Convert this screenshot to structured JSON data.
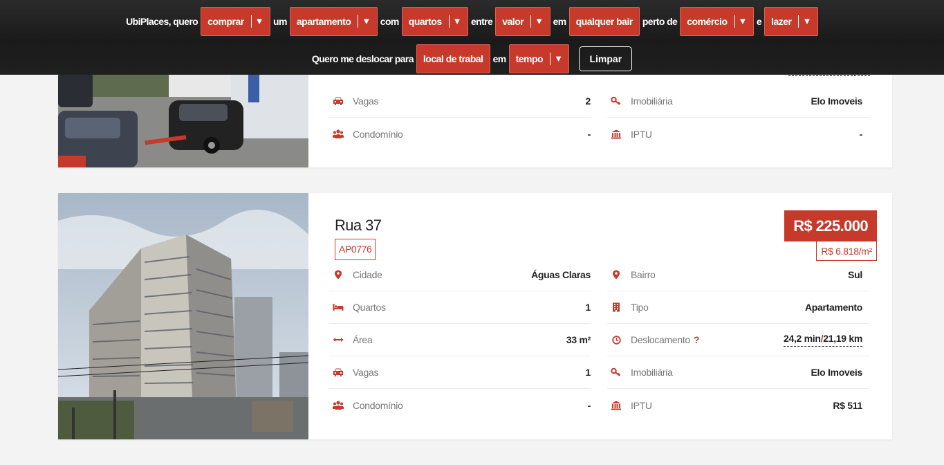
{
  "search_bar": {
    "row1": {
      "intro": "UbiPlaces, quero",
      "action": "comprar",
      "word_um": "um",
      "type": "apartamento",
      "word_com": "com",
      "rooms": "quartos",
      "word_entre": "entre",
      "price": "valor",
      "word_em": "em",
      "neighborhood": "qualquer bair",
      "word_perto": "perto de",
      "near": "comércio",
      "word_e": "e",
      "leisure": "lazer"
    },
    "row2": {
      "intro": "Quero me deslocar para",
      "destination": "local de trabal",
      "word_em": "em",
      "time": "tempo",
      "clear_label": "Limpar"
    },
    "arrow_glyph": "▼"
  },
  "listings": [
    {
      "rows_left": [
        {
          "label": "Vagas",
          "value": "2"
        },
        {
          "label": "Condomínio",
          "value": "-"
        }
      ],
      "rows_right": [
        {
          "label": "Imobiliária",
          "value": "Elo Imoveis"
        },
        {
          "label": "IPTU",
          "value": "-"
        }
      ]
    },
    {
      "title": "Rua 37",
      "code": "AP0776",
      "price": "R$ 225.000",
      "price_per_m2": "R$ 6.818/m²",
      "rows_left": [
        {
          "label": "Cidade",
          "value": "Águas Claras"
        },
        {
          "label": "Quartos",
          "value": "1"
        },
        {
          "label": "Área",
          "value": "33 m²"
        },
        {
          "label": "Vagas",
          "value": "1"
        },
        {
          "label": "Condomínio",
          "value": "-"
        }
      ],
      "rows_right": [
        {
          "label": "Bairro",
          "value": "Sul"
        },
        {
          "label": "Tipo",
          "value": "Apartamento"
        },
        {
          "label": "Deslocamento",
          "help": "?",
          "value_time": "24,2 min",
          "value_sep": "/",
          "value_dist": "21,19 km"
        },
        {
          "label": "Imobiliária",
          "value": "Elo Imoveis"
        },
        {
          "label": "IPTU",
          "value": "R$ 511"
        }
      ]
    }
  ],
  "icons": [
    "car-icon",
    "users-icon",
    "key-icon",
    "bank-icon",
    "map-pin-icon",
    "bed-icon",
    "arrows-h-icon",
    "building-icon",
    "clock-icon"
  ],
  "colors": {
    "accent": "#c7392a",
    "background": "#f3f3f3",
    "header": "#1f1f1f"
  }
}
